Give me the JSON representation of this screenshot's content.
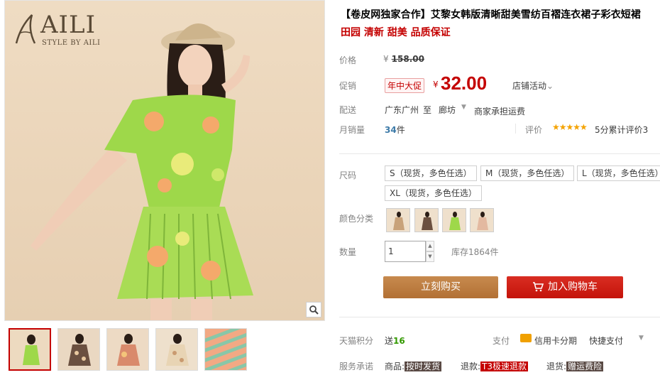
{
  "brand": {
    "name": "AILI",
    "sub": "STYLE BY AILI"
  },
  "product": {
    "title": "【卷皮网独家合作】艾黎女韩版清晰甜美雪纺百褶连衣裙子彩衣短裙",
    "subtitle": "田园 清新 甜美 品质保证"
  },
  "price": {
    "label": "价格",
    "currency": "¥",
    "original": "158.00",
    "promo_label": "促销",
    "promo_tag": "年中大促",
    "promo_currency": "¥",
    "promo_price": "32.00",
    "shop_activity": "店铺活动",
    "shop_activity_caret": "⌄"
  },
  "shipping": {
    "label": "配送",
    "from": "广东广州",
    "to": "至",
    "city": "廊坊",
    "fee": "商家承担运费"
  },
  "sales": {
    "label": "月销量",
    "count": "34",
    "unit": "件",
    "rating_label": "评价",
    "stars": "★★★★★",
    "rating_text": "5分累计评价3"
  },
  "size": {
    "label": "尺码",
    "options": [
      "S（现货，多色任选）",
      "M（现货，多色任选）",
      "L（现货，多色任选）",
      "XL（现货，多色任选）"
    ]
  },
  "color": {
    "label": "颜色分类"
  },
  "quantity": {
    "label": "数量",
    "value": "1",
    "stock": "库存1864件"
  },
  "buttons": {
    "buy": "立刻购买",
    "cart": "加入购物车"
  },
  "points": {
    "label": "天猫积分",
    "prefix": "送",
    "value": "16"
  },
  "payment": {
    "label": "支付",
    "credit": "信用卡分期",
    "quick": "快捷支付"
  },
  "service": {
    "label": "服务承诺",
    "items": [
      {
        "prefix": "商品:",
        "tag": "按时发货"
      },
      {
        "prefix": "退款:",
        "tag": "T3极速退款"
      },
      {
        "prefix": "退货:",
        "tag": "赠运费险"
      }
    ]
  },
  "colors": {
    "accent": "#c40000",
    "buy_button": "#b9793f",
    "cart_button": "#c4130a",
    "star": "#f4a300"
  },
  "icons": {
    "zoom": "magnifier-icon",
    "cart": "cart-icon",
    "card": "credit-card-icon"
  }
}
